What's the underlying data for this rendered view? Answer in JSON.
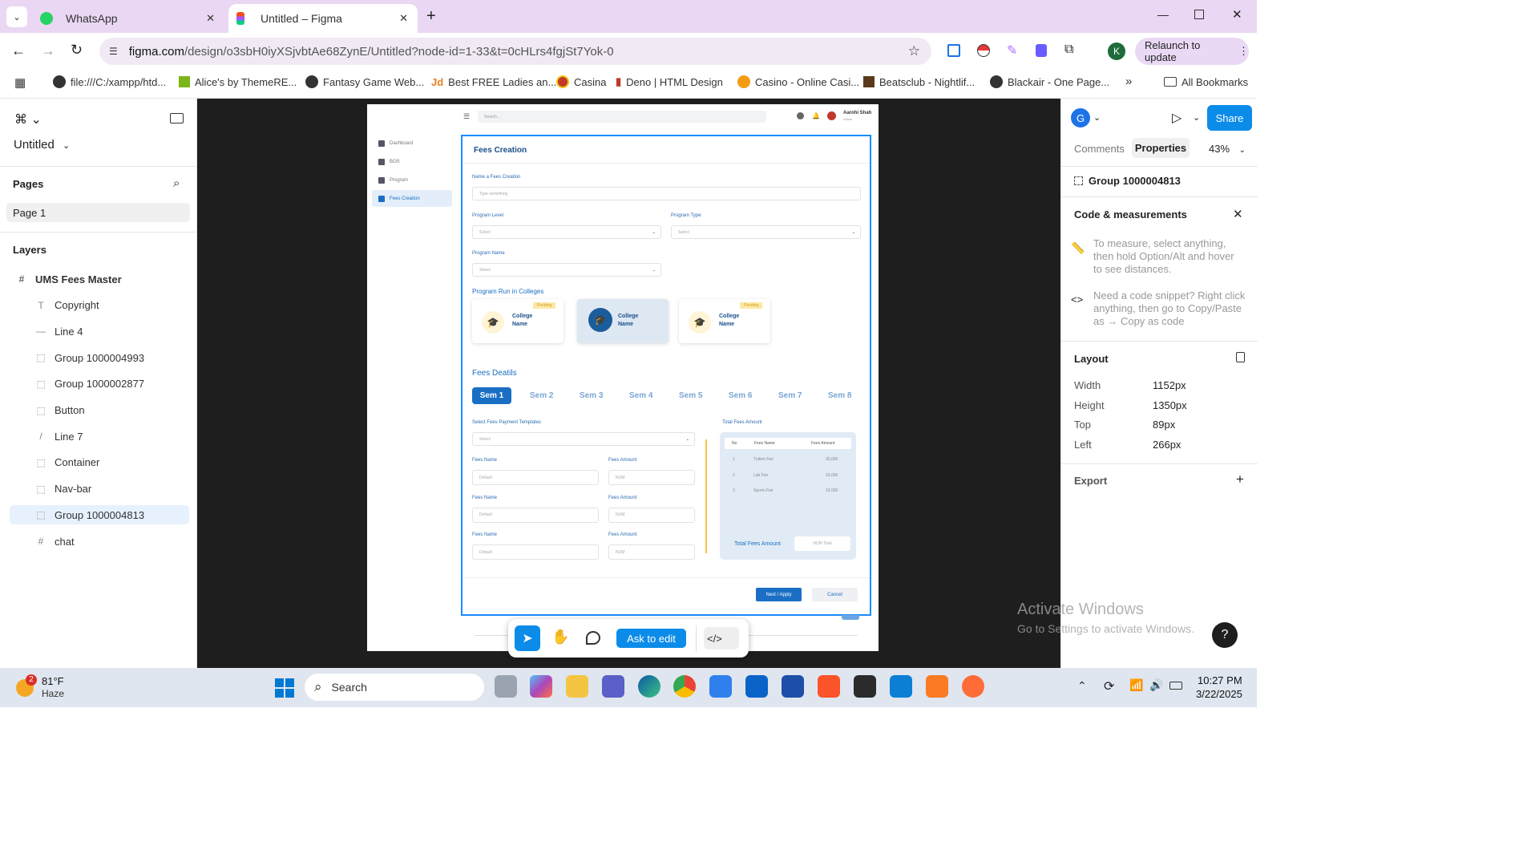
{
  "browser": {
    "tabs": [
      {
        "title": "WhatsApp",
        "icon": "whatsapp-icon",
        "active": false
      },
      {
        "title": "Untitled – Figma",
        "icon": "figma-icon",
        "active": true
      }
    ],
    "url_host": "figma.com",
    "url_path": "/design/o3sbH0iyXSjvbtAe68ZynE/Untitled?node-id=1-33&t=0cHLrs4fgjSt7Yok-0",
    "relaunch_label": "Relaunch to update",
    "profile_initial": "K",
    "bookmarks": [
      "file:///C:/xampp/htd...",
      "Alice's by ThemeRE...",
      "Fantasy Game Web...",
      "Best FREE Ladies an...",
      "Casina",
      "Deno | HTML Design",
      "Casino - Online Casi...",
      "Beatsclub - Nightlif...",
      "Blackair - One Page..."
    ],
    "all_bookmarks": "All Bookmarks"
  },
  "figma_left": {
    "file_name": "Untitled",
    "pages_title": "Pages",
    "page_item": "Page 1",
    "layers_title": "Layers",
    "layers": [
      {
        "name": "UMS Fees Master",
        "icon": "#",
        "top": true
      },
      {
        "name": "Copyright",
        "icon": "T"
      },
      {
        "name": "Line 4",
        "icon": "—"
      },
      {
        "name": "Group 1000004993",
        "icon": "⬚"
      },
      {
        "name": "Group 1000002877",
        "icon": "⬚"
      },
      {
        "name": "Button",
        "icon": "⬚"
      },
      {
        "name": "Line 7",
        "icon": "/"
      },
      {
        "name": "Container",
        "icon": "⬚"
      },
      {
        "name": "Nav-bar",
        "icon": "⬚"
      },
      {
        "name": "Group 1000004813",
        "icon": "⬚",
        "selected": true
      },
      {
        "name": "chat",
        "icon": "#"
      }
    ]
  },
  "design": {
    "search_placeholder": "Search...",
    "user_name": "Aarohi Shah",
    "user_role": "Admin",
    "sidebar": [
      "Dashboard",
      "BOS",
      "Program",
      "Fees Creation"
    ],
    "form_title": "Fees Creation",
    "name_label": "Name a Fees Creation",
    "name_placeholder": "Type something",
    "program_level": "Program Level",
    "program_type": "Program Type",
    "program_name": "Program Name",
    "select": "Select",
    "colleges_title": "Program Run in Colleges",
    "college_name_1": "College",
    "college_name_2": "Name",
    "pending": "Pending",
    "fees_details": "Fees Deatils",
    "sems": [
      "Sem 1",
      "Sem 2",
      "Sem 3",
      "Sem 4",
      "Sem 5",
      "Sem 6",
      "Sem 7",
      "Sem 8"
    ],
    "template_label": "Select Fees Payment Templates",
    "fees_name": "Fees Name",
    "fees_amount": "Fees Amount",
    "default": "Default",
    "num": "NUM",
    "total_fees_amount": "Total Fees Amount",
    "table_headers": [
      "No",
      "Fees Name",
      "Fees Amount"
    ],
    "table_rows": [
      [
        "1",
        "Tuition Fee",
        "30,000"
      ],
      [
        "2",
        "Lab Fee",
        "10,000"
      ],
      [
        "3",
        "Sports Fee",
        "10,000"
      ]
    ],
    "num_total": "NUM Total",
    "next_apply": "Next / Apply",
    "cancel": "Cancel"
  },
  "toolbar": {
    "ask_to_edit": "Ask to edit"
  },
  "figma_right": {
    "avatar": "G",
    "share": "Share",
    "tab_comments": "Comments",
    "tab_properties": "Properties",
    "zoom": "43%",
    "selection": "Group 1000004813",
    "code_title": "Code & measurements",
    "measure_hint": "To measure, select anything, then hold Option/Alt and hover to see distances.",
    "code_hint": "Need a code snippet? Right click anything, then go to Copy/Paste as → Copy as code",
    "layout_title": "Layout",
    "layout": [
      {
        "k": "Width",
        "v": "1152px"
      },
      {
        "k": "Height",
        "v": "1350px"
      },
      {
        "k": "Top",
        "v": "89px"
      },
      {
        "k": "Left",
        "v": "266px"
      }
    ],
    "export": "Export"
  },
  "watermark": {
    "line1": "Activate Windows",
    "line2": "Go to Settings to activate Windows."
  },
  "taskbar": {
    "weather_temp": "81°F",
    "weather_desc": "Haze",
    "weather_badge": "2",
    "search": "Search",
    "time": "10:27 PM",
    "date": "3/22/2025"
  },
  "colors": {
    "accent": "#0d6efd",
    "figma_blue": "#0c8ce9",
    "design_blue": "#1a6fc4",
    "tabbar": "#e9d7f3"
  }
}
